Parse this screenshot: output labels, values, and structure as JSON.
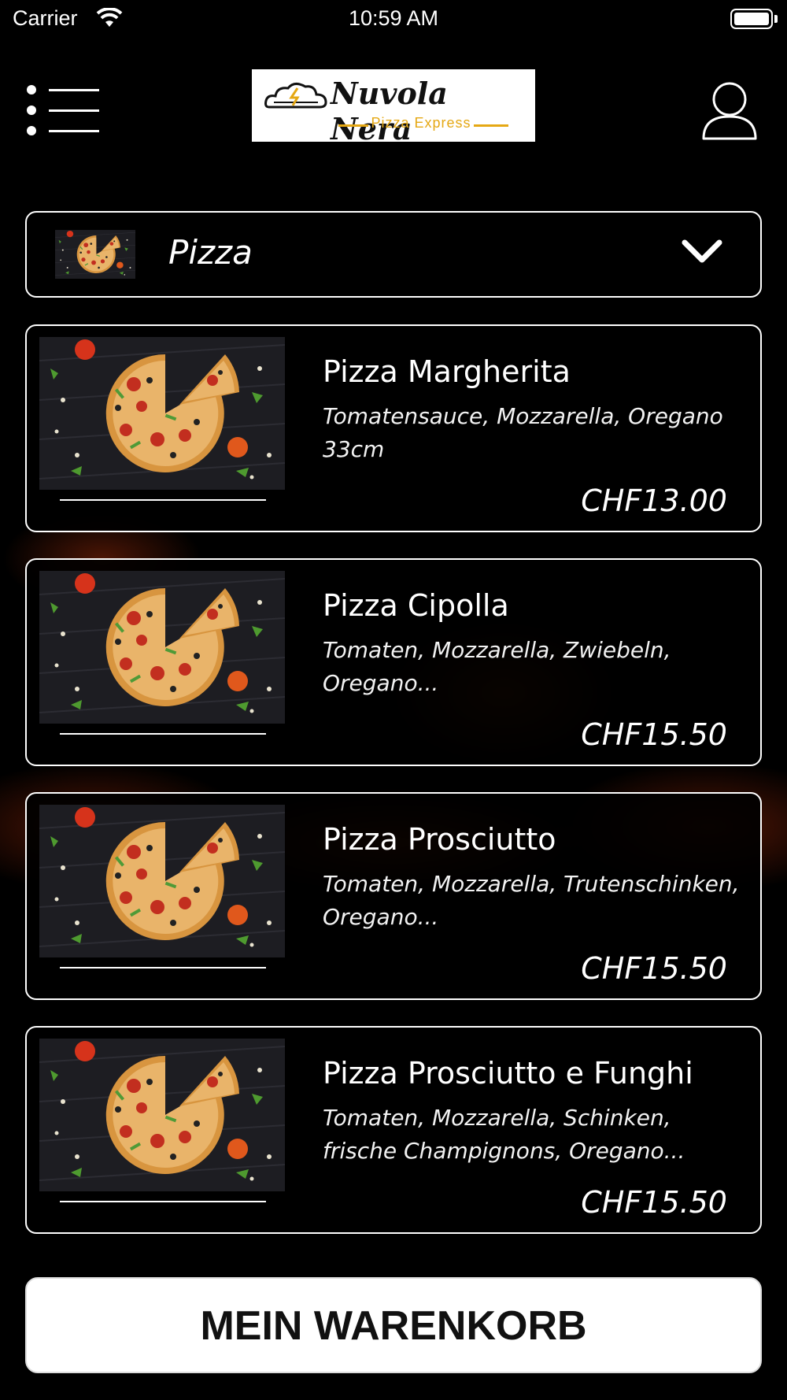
{
  "status_bar": {
    "carrier": "Carrier",
    "time": "10:59 AM"
  },
  "header": {
    "logo_name": "Nuvola Nera",
    "logo_tagline": "Pizza Express",
    "logo_accent_color": "#e5a814",
    "menu_icon": "menu-icon",
    "profile_icon": "user-profile-icon"
  },
  "category": {
    "selected": "Pizza",
    "icon": "chevron-down-icon"
  },
  "products": [
    {
      "name": "Pizza Margherita",
      "description": "Tomatensauce, Mozzarella, Oregano 33cm",
      "price": "CHF13.00"
    },
    {
      "name": "Pizza Cipolla",
      "description": "Tomaten, Mozzarella, Zwiebeln, Oregano...",
      "price": "CHF15.50"
    },
    {
      "name": "Pizza Prosciutto",
      "description": "Tomaten, Mozzarella, Trutenschinken, Oregano...",
      "price": "CHF15.50"
    },
    {
      "name": "Pizza Prosciutto e Funghi",
      "description": "Tomaten, Mozzarella, Schinken, frische Champignons, Oregano...",
      "price": "CHF15.50"
    }
  ],
  "cart": {
    "label": "MEIN WARENKORB"
  }
}
